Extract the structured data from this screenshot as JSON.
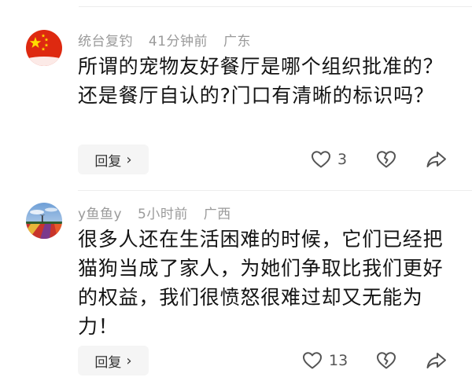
{
  "comments": [
    {
      "username": "统台复钓",
      "time": "41分钟前",
      "location": "广东",
      "avatar": "china-flag-icon",
      "text": "所谓的宠物友好餐厅是哪个组织批准的？还是餐厅自认的?门口有清晰的标识吗？",
      "reply_label": "回复",
      "likes": "3"
    },
    {
      "username": "y鱼鱼y",
      "time": "5小时前",
      "location": "广西",
      "avatar": "landscape-photo-avatar",
      "text": "很多人还在生活困难的时候，它们已经把猫狗当成了家人，为她们争取比我们更好的权益，我们很愤怒很难过却又无能为力！",
      "reply_label": "回复",
      "likes": "13"
    }
  ],
  "colors": {
    "meta_text": "#9a9a9a",
    "body_text": "#141414",
    "reply_bg": "#f5f5f5",
    "icon_stroke": "#555555",
    "flag_red": "#de2910",
    "flag_yellow": "#ffde00"
  }
}
